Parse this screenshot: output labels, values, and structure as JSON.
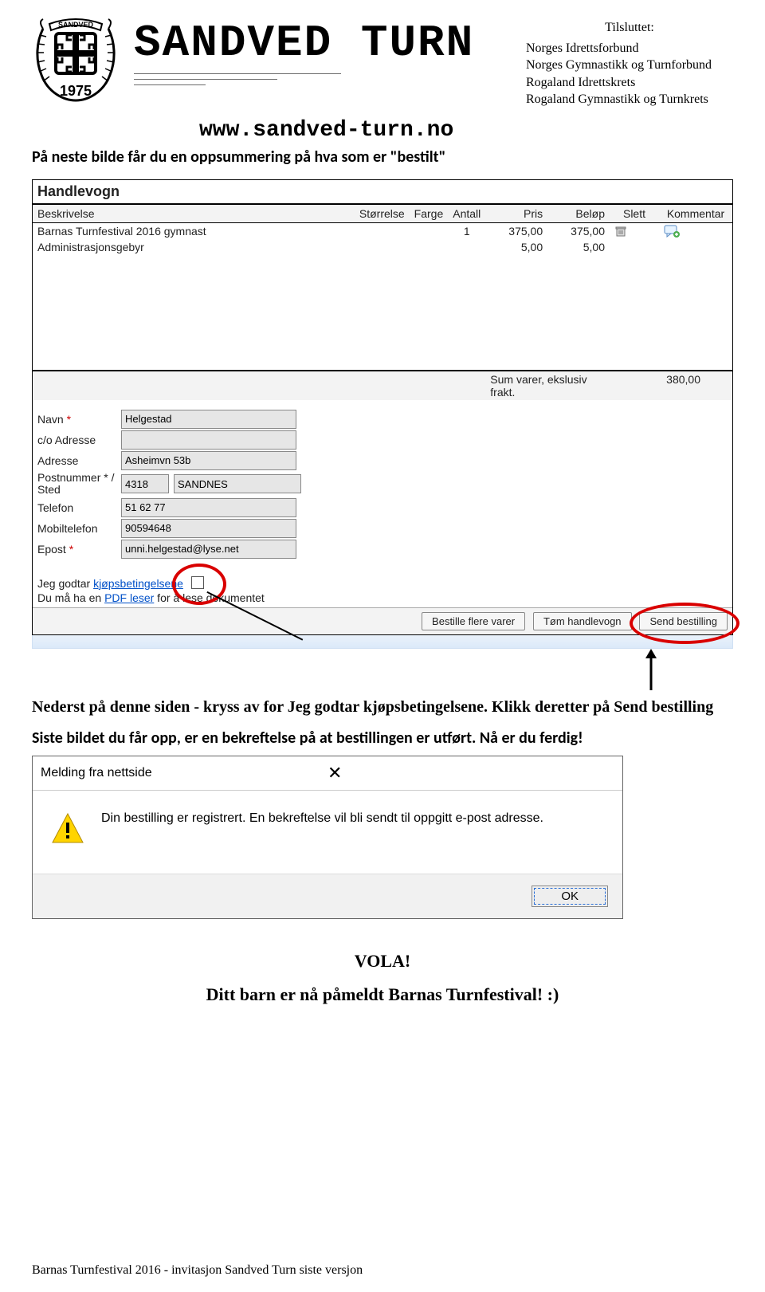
{
  "header": {
    "title": "SANDVED TURN",
    "logo_year": "1975",
    "logo_name": "SANDVED",
    "affiliated_title": "Tilsluttet:",
    "affiliations": [
      "Norges Idrettsforbund",
      "Norges Gymnastikk og Turnforbund",
      "Rogaland Idrettskrets",
      "Rogaland Gymnastikk og Turnkrets"
    ],
    "url": "www.sandved-turn.no"
  },
  "intro_text": "På neste bilde får du en oppsummering på hva som er \"bestilt\"",
  "cart": {
    "title": "Handlevogn",
    "columns": {
      "desc": "Beskrivelse",
      "size": "Størrelse",
      "color": "Farge",
      "qty": "Antall",
      "price": "Pris",
      "amount": "Beløp",
      "delete": "Slett",
      "comment": "Kommentar"
    },
    "rows": [
      {
        "desc": "Barnas Turnfestival 2016 gymnast",
        "size": "",
        "color": "",
        "qty": "1",
        "price": "375,00",
        "amount": "375,00",
        "has_delete": true,
        "has_comment": true
      },
      {
        "desc": "Administrasjonsgebyr",
        "size": "",
        "color": "",
        "qty": "",
        "price": "5,00",
        "amount": "5,00",
        "has_delete": false,
        "has_comment": false
      }
    ],
    "sum_label": "Sum varer, ekslusiv frakt.",
    "sum_value": "380,00"
  },
  "form": {
    "labels": {
      "name": "Navn",
      "co": "c/o Adresse",
      "address": "Adresse",
      "zipcity": "Postnummer * / Sted",
      "phone": "Telefon",
      "mobile": "Mobiltelefon",
      "email": "Epost"
    },
    "required_mark": "*",
    "values": {
      "name": "Helgestad",
      "co": "",
      "address": "Asheimvn 53b",
      "zip": "4318",
      "city": "SANDNES",
      "phone": "51 62 77",
      "mobile": "90594648",
      "email": "unni.helgestad@lyse.net"
    },
    "terms_prefix": "Jeg godtar ",
    "terms_link": "kjøpsbetingelsene",
    "pdf_prefix": "Du må ha en ",
    "pdf_link": "PDF leser",
    "pdf_suffix": " for å lese dokumentet"
  },
  "buttons": {
    "more": "Bestille flere varer",
    "empty": "Tøm handlevogn",
    "send": "Send bestilling"
  },
  "mid_paragraph": "Nederst på denne siden - kryss av for Jeg godtar kjøpsbetingelsene. Klikk deretter på Send bestilling",
  "mid_paragraph2": "Siste bildet du får opp, er en bekreftelse på at bestillingen er utført. Nå er du ferdig!",
  "dialog": {
    "title": "Melding fra nettside",
    "message": "Din bestilling er registrert. En bekreftelse vil bli sendt til oppgitt e-post adresse.",
    "ok": "OK"
  },
  "vola": "VOLA!",
  "enrolled": "Ditt barn er nå påmeldt Barnas Turnfestival! :)",
  "footer": "Barnas Turnfestival 2016 -  invitasjon Sandved Turn siste versjon",
  "chart_data": {
    "type": "table",
    "title": "Handlevogn",
    "columns": [
      "Beskrivelse",
      "Størrelse",
      "Farge",
      "Antall",
      "Pris",
      "Beløp"
    ],
    "rows": [
      [
        "Barnas Turnfestival 2016 gymnast",
        "",
        "",
        "1",
        "375,00",
        "375,00"
      ],
      [
        "Administrasjonsgebyr",
        "",
        "",
        "",
        "5,00",
        "5,00"
      ]
    ],
    "summary": {
      "label": "Sum varer, ekslusiv frakt.",
      "value": "380,00"
    }
  }
}
